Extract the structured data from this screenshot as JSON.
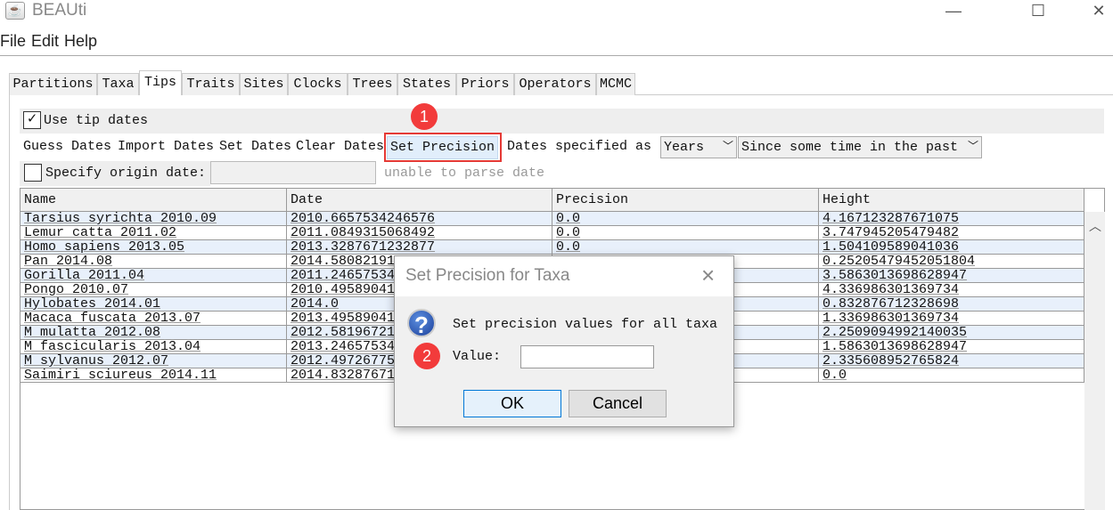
{
  "window": {
    "title": "BEAUti",
    "icon": "java-cup-icon",
    "minimize": "—",
    "maximize": "☐",
    "close": "✕"
  },
  "menu": [
    "File",
    "Edit",
    "Help"
  ],
  "tabs": [
    {
      "label": "Partitions"
    },
    {
      "label": "Taxa"
    },
    {
      "label": "Tips",
      "selected": true
    },
    {
      "label": "Traits"
    },
    {
      "label": "Sites"
    },
    {
      "label": "Clocks"
    },
    {
      "label": "Trees"
    },
    {
      "label": "States"
    },
    {
      "label": "Priors"
    },
    {
      "label": "Operators"
    },
    {
      "label": "MCMC"
    }
  ],
  "tips": {
    "use_tip_dates": {
      "label": "Use tip dates",
      "checked": true
    },
    "buttons": {
      "guess": "Guess Dates",
      "import": "Import Dates",
      "set": "Set Dates",
      "clear": "Clear Dates",
      "precision": "Set Precision"
    },
    "dates_specified_label": "Dates specified as",
    "units": "Years",
    "direction": "Since some time in the past",
    "origin": {
      "label": "Specify origin date:",
      "checked": false,
      "value": "",
      "status": "unable to parse date"
    }
  },
  "annotations": {
    "step1": "1",
    "step2": "2",
    "highlight_color": "#e53935"
  },
  "table": {
    "columns": [
      "Name",
      "Date",
      "Precision",
      "Height"
    ],
    "rows": [
      [
        "Tarsius syrichta 2010.09",
        "2010.6657534246576",
        "0.0",
        "4.167123287671075"
      ],
      [
        "Lemur catta 2011.02",
        "2011.0849315068492",
        "0.0",
        "3.747945205479482"
      ],
      [
        "Homo sapiens 2013.05",
        "2013.3287671232877",
        "0.0",
        "1.504109589041036"
      ],
      [
        "Pan 2014.08",
        "2014.58082191",
        "",
        "0.25205479452051804"
      ],
      [
        "Gorilla 2011.04",
        "2011.24657534",
        "",
        "3.5863013698628947"
      ],
      [
        "Pongo 2010.07",
        "2010.49589041",
        "",
        "4.336986301369734"
      ],
      [
        "Hylobates 2014.01",
        "2014.0",
        "",
        "0.832876712328698"
      ],
      [
        "Macaca fuscata 2013.07",
        "2013.49589041",
        "",
        "1.336986301369734"
      ],
      [
        "M mulatta 2012.08",
        "2012.58196721",
        "",
        "2.2509094992140035"
      ],
      [
        "M fascicularis 2013.04",
        "2013.24657534",
        "",
        "1.5863013698628947"
      ],
      [
        "M sylvanus 2012.07",
        "2012.49726775",
        "",
        "2.335608952765824"
      ],
      [
        "Saimiri sciureus 2014.11",
        "2014.83287671",
        "",
        "0.0"
      ]
    ]
  },
  "dialog": {
    "title": "Set Precision for Taxa",
    "icon": "question-icon",
    "message": "Set precision values for all taxa",
    "value_label": "Value:",
    "value": "",
    "ok": "OK",
    "cancel": "Cancel"
  }
}
